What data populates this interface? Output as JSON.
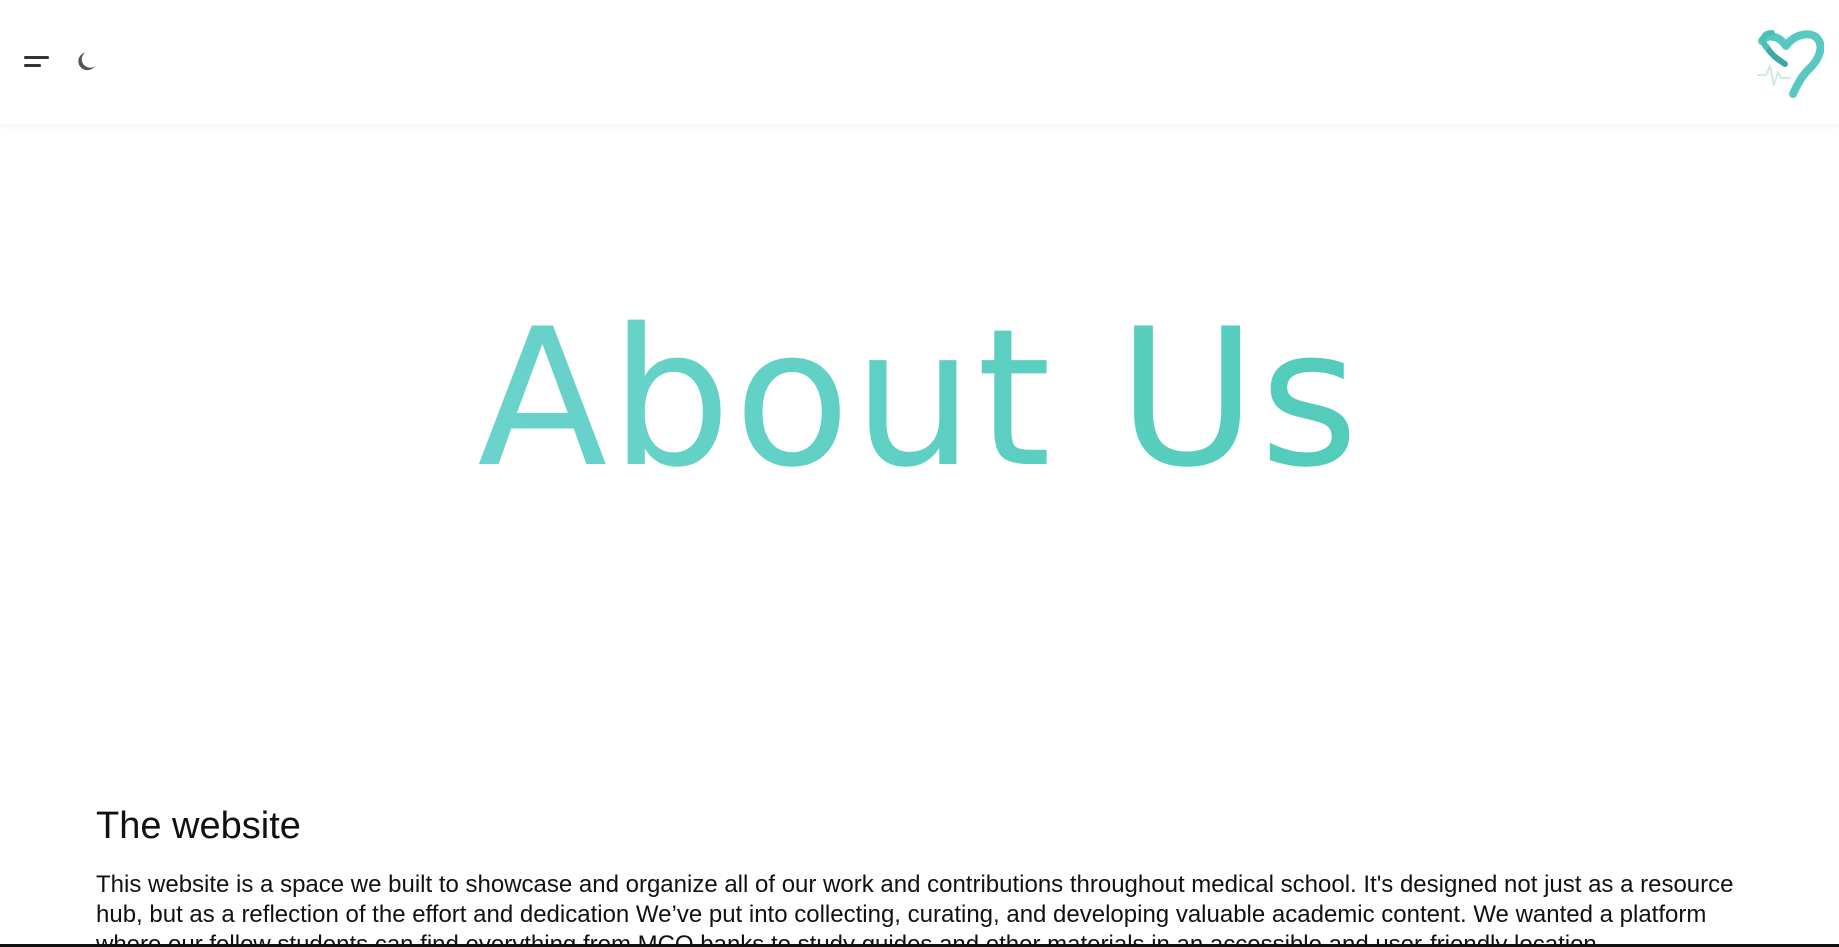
{
  "header": {
    "menu_icon": "menu-icon",
    "theme_icon": "moon-icon",
    "logo_icon": "heart-heartbeat-logo",
    "accent_color": "#55ccbf"
  },
  "hero": {
    "title": "About Us"
  },
  "website_section": {
    "title": "The website",
    "text": "This website is a space we built to showcase and organize all of our work and contributions throughout medical school. It's designed not just as a resource hub, but as a reflection of the effort and dedication We’ve put into collecting, curating, and developing valuable academic content. We wanted a platform where our fellow students can find everything from MCQ banks to study guides and other materials in an accessible and user-friendly location."
  }
}
